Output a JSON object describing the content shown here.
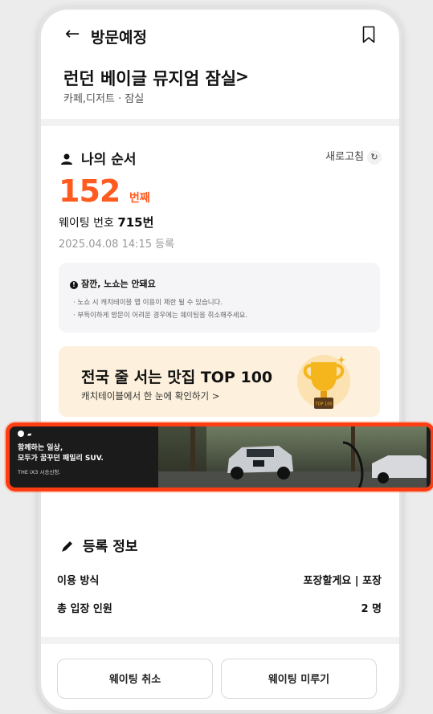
{
  "header": {
    "back_icon": "arrow-left-icon",
    "title": "방문예정",
    "bookmark_icon": "bookmark-icon"
  },
  "store": {
    "name": "런던 베이글 뮤지엄 잠실",
    "chevron": ">",
    "category": "카페,디저트 · 잠실"
  },
  "queue": {
    "heading": "나의 순서",
    "refresh_label": "새로고침",
    "refresh_icon": "refresh-icon",
    "position_number": "152",
    "position_unit": "번째",
    "waiting_label": "웨이팅 번호",
    "waiting_number": "715번",
    "registered_at": "2025.04.08 14:15 등록"
  },
  "notice": {
    "title": "잠깐, 노쇼는 안돼요",
    "lines": [
      "노쇼 시 캐치테이블 앱 이용이 제한 될 수 있습니다.",
      "부득이하게 방문이 어려운 경우에는 웨이팅을 취소해주세요."
    ]
  },
  "promo": {
    "title": "전국 줄 서는 맛집 TOP 100",
    "subtitle": "캐치테이블에서 한 눈에 확인하기 >",
    "trophy_icon": "trophy-icon",
    "trophy_label": "TOP 100"
  },
  "ad": {
    "brand_icon": "bmw-logo-icon",
    "line1": "함께하는 일상,",
    "line2": "모두가 꿈꾸던 패밀리 SUV.",
    "line3": "THE iX3 시승신청."
  },
  "registration": {
    "heading": "등록 정보",
    "rows": [
      {
        "label": "이용 방식",
        "value": "포장할게요 | 포장"
      },
      {
        "label": "총 입장 인원",
        "value": "2 명"
      }
    ]
  },
  "actions": {
    "cancel_label": "웨이팅 취소",
    "postpone_label": "웨이팅 미루기"
  },
  "colors": {
    "accent": "#ff5a1f",
    "ad_border": "#ff3d12",
    "promo_bg": "#fdf0dc"
  }
}
